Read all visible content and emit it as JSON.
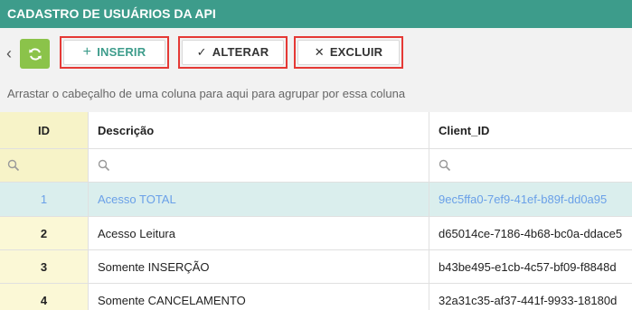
{
  "title": "CADASTRO DE USUÁRIOS DA API",
  "toolbar": {
    "inserir_label": "INSERIR",
    "alterar_label": "ALTERAR",
    "excluir_label": "EXCLUIR",
    "inserir_icon": "plus-icon",
    "alterar_icon": "check-icon",
    "excluir_icon": "x-icon",
    "refresh_icon": "refresh-icon"
  },
  "group_hint": "Arrastar o cabeçalho de uma coluna para aqui para agrupar por essa coluna",
  "grid": {
    "columns": [
      "ID",
      "Descrição",
      "Client_ID"
    ],
    "rows": [
      {
        "id": "1",
        "descricao": "Acesso TOTAL",
        "client_id": "9ec5ffa0-7ef9-41ef-b89f-dd0a95"
      },
      {
        "id": "2",
        "descricao": "Acesso Leitura",
        "client_id": "d65014ce-7186-4b68-bc0a-ddace5"
      },
      {
        "id": "3",
        "descricao": "Somente INSERÇÃO",
        "client_id": "b43be495-e1cb-4c57-bf09-f8848d"
      },
      {
        "id": "4",
        "descricao": "Somente CANCELAMENTO",
        "client_id": "32a31c35-af37-441f-9933-18180d"
      }
    ]
  },
  "colors": {
    "titlebar": "#3d9c8b",
    "refresh_button": "#8bc34a",
    "highlight_frame": "#e53935",
    "id_column": "#fbf8d6",
    "selected_row": "#daeeed",
    "selected_text": "#6aa0e8"
  }
}
